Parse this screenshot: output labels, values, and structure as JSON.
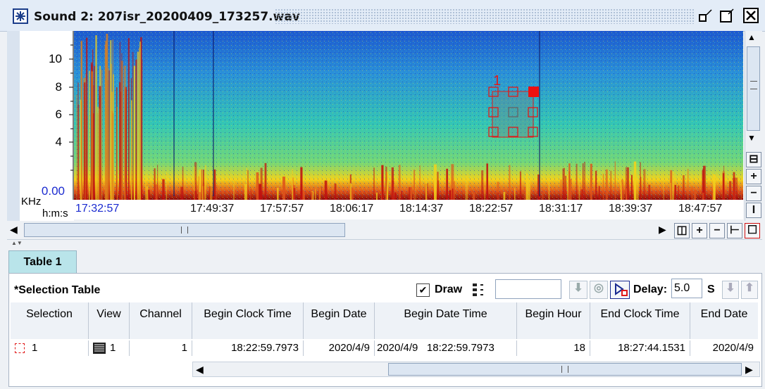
{
  "window": {
    "title": "Sound 2: 207isr_20200409_173257.wav"
  },
  "spectrogram": {
    "y_unit": "KHz",
    "x_unit": "h:m:s",
    "y_ticks": [
      "10",
      "8",
      "6",
      "4",
      "0.00"
    ],
    "time_start": "17:32:57",
    "time_ticks": [
      "17:49:37",
      "17:57:57",
      "18:06:17",
      "18:14:37",
      "18:22:57",
      "18:31:17",
      "18:39:37",
      "18:47:57"
    ],
    "selection_label": "1",
    "colors": {
      "low": "#1a4fc4",
      "mid": "#34c9a6",
      "high": "#f3d21a",
      "peak": "#c01010",
      "selection": "#e01a1a"
    }
  },
  "table_tab": {
    "label": "Table 1"
  },
  "selection_table": {
    "title": "*Selection Table",
    "draw_label": "Draw",
    "draw_checked": true,
    "delay_label": "Delay:",
    "delay_value": "5.0",
    "delay_unit": "S",
    "columns": [
      "Selection",
      "View",
      "Channel",
      "Begin Clock Time",
      "Begin Date",
      "Begin Date Time",
      "Begin Hour",
      "End Clock Time",
      "End Date"
    ],
    "rows": [
      {
        "selection": "1",
        "view": "1",
        "channel": "1",
        "begin_clock": "18:22:59.7973",
        "begin_date": "2020/4/9",
        "begin_date_time": "2020/4/9   18:22:59.7973",
        "begin_hour": "18",
        "end_clock": "18:27:44.1531",
        "end_date": "2020/4/9"
      }
    ]
  }
}
